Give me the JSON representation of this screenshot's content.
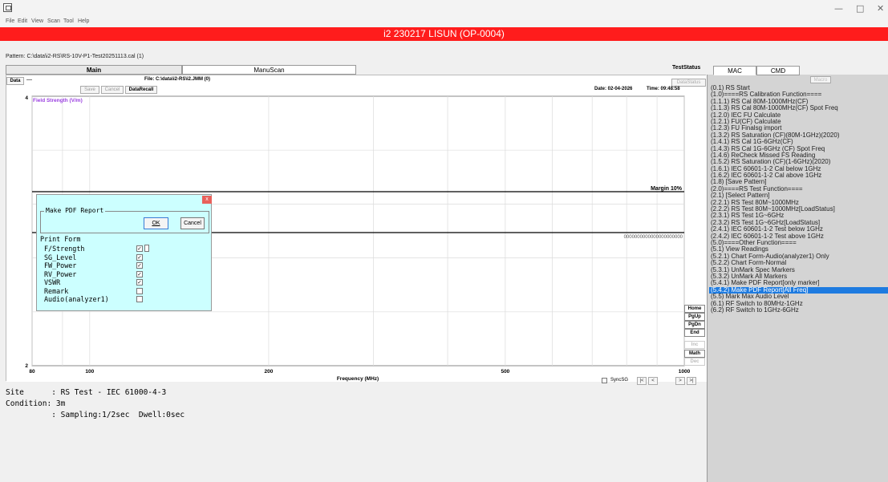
{
  "window": {
    "menu": [
      "File",
      "Edit",
      "View",
      "Scan",
      "Tool",
      "Help"
    ],
    "controls": {
      "minimize": "—",
      "maximize": "□",
      "close": "✕"
    }
  },
  "app_title": "i2 230217 LISUN (OP-0004)",
  "pattern": "Pattern: C:\\data\\i2-RS\\RS-10V-P1-Test20251113.cal (1)",
  "tabs": {
    "main": "Main",
    "manuscan": "ManuScan",
    "teststatus": "TestStatus"
  },
  "chart_toolbar": {
    "data_label": "Data",
    "data_dash": "—",
    "file": "File: C:\\data\\i2-RS\\i2.JMM (0)",
    "save": "Save",
    "cancel": "Cancel",
    "datarecall": "DataRecall",
    "datastatus": "DataStatus",
    "date": "Date: 02-04-2026",
    "time": "Time: 09:48:58"
  },
  "chart_data": {
    "type": "line",
    "title": "",
    "xlabel": "Frequency (MHz)",
    "ylabel": "Field Strength (V/m)",
    "x_scale": "log",
    "xlim": [
      80,
      1000
    ],
    "ylim": [
      2,
      4
    ],
    "x_tick_labels": [
      "80",
      "100",
      "200",
      "500",
      "1000"
    ],
    "y_tick_labels": [
      "4",
      "2"
    ],
    "grid": true,
    "annotations": [
      "Margin 10%",
      "0000000000000000000000"
    ],
    "series": []
  },
  "chart_bottom": {
    "syncsg": "SyncSG",
    "nav": [
      "|<",
      "<",
      ">",
      ">|"
    ]
  },
  "side_buttons": [
    "Home",
    "PgUp",
    "PgDn",
    "End",
    "Inc",
    "Math",
    "Dec"
  ],
  "side_buttons_dim": [
    "Inc",
    "Dec"
  ],
  "info_lines": [
    "Site      : RS Test - IEC 61000-4-3",
    "Condition: 3m",
    "          : Sampling:1/2sec  Dwell:0sec"
  ],
  "right_tabs": {
    "mac": "MAC",
    "cmd": "CMD",
    "macro": "Macro"
  },
  "mac_items": [
    "(0.1) RS Start",
    "(1.0)====RS Calibration Function====",
    "(1.1.1) RS Cal 80M-1000MHz(CF)",
    "(1.1.3) RS Cal 80M-1000MHz(CF) Spot Freq",
    "(1.2.0) IEC FU Calculate",
    "(1.2.1) FU(CF) Calculate",
    "(1.2.3) FU Finalsg import",
    "(1.3.2) RS Saturation (CF)(80M-1GHz)(2020)",
    "(1.4.1) RS Cal 1G-6GHz(CF)",
    "(1.4.3) RS Cal 1G-6GHz (CF) Spot Freq",
    "(1.4.6) ReCheck Missed FS Reading",
    "(1.5.2) RS Saturation (CF)(1-6GHz)(2020)",
    "(1.6.1) IEC 60601-1-2 Cal below 1GHz",
    "(1.6.2) IEC 60601-1-2 Cal above 1GHz",
    "(1.8) [Save Pattern]",
    "(2.0)====RS Test Function====",
    "(2.1) [Select Pattern]",
    "(2.2.1) RS Test 80M~1000MHz",
    "(2.2.2) RS Test 80M~1000MHz[LoadStatus]",
    "(2.3.1) RS Test 1G~6GHz",
    "(2.3.2) RS Test 1G~6GHz[LoadStatus]",
    "(2.4.1) IEC 60601-1-2 Test below 1GHz",
    "(2.4.2) IEC 60601-1-2 Test above 1GHz",
    "(5.0)====Other Function====",
    "(5.1) View Readings",
    "(5.2.1) Chart Form-Audio(analyzer1) Only",
    "(5.2.2) Chart Form-Normal",
    "(5.3.1) UnMark Spec Markers",
    "(5.3.2) UnMark All Markers",
    "(5.4.1) Make PDF Report[only marker]",
    "(5.4.2) Make PDF Report[All Freq]",
    "(5.5) Mark Max Audio Level",
    "(6.1) RF Switch to 80MHz-1GHz",
    "(6.2) RF Switch to 1GHz-6GHz"
  ],
  "mac_selected_index": 30,
  "dialog": {
    "close": "x",
    "title": "Make PDF Report",
    "ok": "OK",
    "cancel": "Cancel",
    "print_form": "Print Form",
    "items": [
      {
        "label": "F/Strength",
        "checked": true
      },
      {
        "label": "SG_Level",
        "checked": true
      },
      {
        "label": "FW_Power",
        "checked": true
      },
      {
        "label": "RV_Power",
        "checked": true
      },
      {
        "label": "VSWR",
        "checked": true
      },
      {
        "label": "Remark",
        "checked": false
      },
      {
        "label": "Audio(analyzer1)",
        "checked": false
      }
    ]
  },
  "colors": {
    "title_bar": "#ff1c1c",
    "selection": "#1e7be0",
    "dialog_bg": "#ccffff",
    "ylabel": "#9a3ee0"
  }
}
